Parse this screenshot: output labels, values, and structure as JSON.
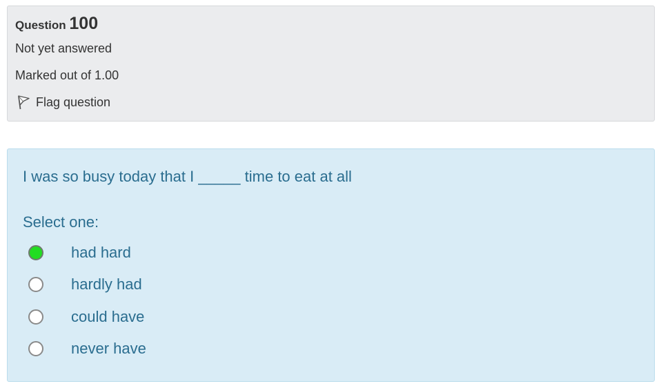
{
  "info": {
    "question_label": "Question",
    "question_number": "100",
    "state": "Not yet answered",
    "grade": "Marked out of 1.00",
    "flag_label": "Flag question"
  },
  "question": {
    "text": "I was so busy today that I _____ time to eat at all",
    "prompt": "Select one:",
    "answers": [
      {
        "label": "had hard",
        "selected": true
      },
      {
        "label": "hardly had",
        "selected": false
      },
      {
        "label": "could have",
        "selected": false
      },
      {
        "label": "never have",
        "selected": false
      }
    ]
  },
  "colors": {
    "info_background": "#ebecee",
    "content_background": "#d9ecf6",
    "content_text": "#2a6d8f",
    "selected_radio": "#22dd22"
  },
  "icons": {
    "flag": "flag-icon"
  }
}
